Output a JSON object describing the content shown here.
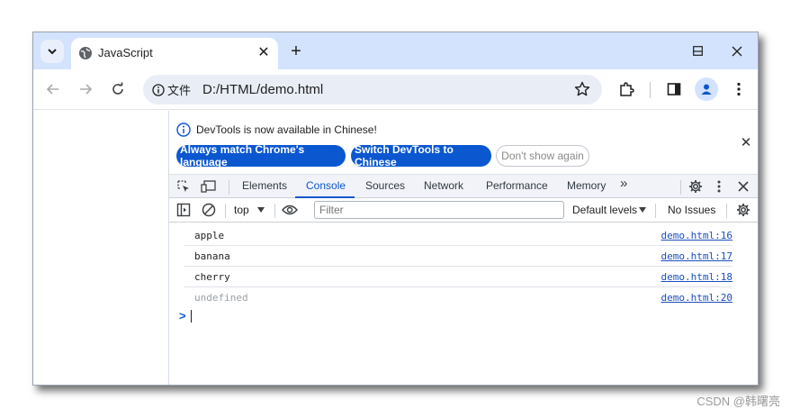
{
  "browser": {
    "tab_title": "JavaScript",
    "new_tab_symbol": "+",
    "close_tab_symbol": "✕",
    "chip_label": "文件",
    "url": "D:/HTML/demo.html"
  },
  "devtools": {
    "info_message": "DevTools is now available in Chinese!",
    "btn_match_language": "Always match Chrome's language",
    "btn_switch_chinese": "Switch DevTools to Chinese",
    "btn_dont_show": "Don't show again",
    "tabs": [
      "Elements",
      "Console",
      "Sources",
      "Network",
      "Performance",
      "Memory"
    ],
    "more_tabs_symbol": "»",
    "active_tab": "Console",
    "context": "top",
    "filter_placeholder": "Filter",
    "levels": "Default levels",
    "issues": "No Issues"
  },
  "console": {
    "rows": [
      {
        "text": "apple",
        "source": "demo.html:16"
      },
      {
        "text": "banana",
        "source": "demo.html:17"
      },
      {
        "text": "cherry",
        "source": "demo.html:18"
      },
      {
        "text": "undefined",
        "source": "demo.html:20"
      }
    ],
    "prompt": ">"
  },
  "watermark": "CSDN @韩曙亮",
  "colors": {
    "accent": "#0b57d0",
    "titlebar": "#d3e3fd",
    "omnibox": "#e9eef6"
  }
}
